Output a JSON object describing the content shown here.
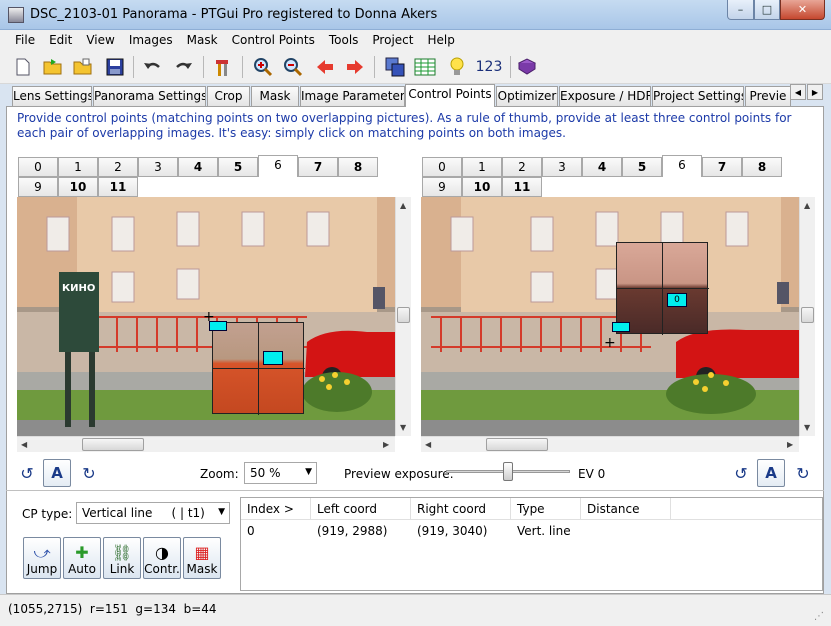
{
  "window": {
    "title": "DSC_2103-01 Panorama - PTGui Pro registered to Donna Akers",
    "min": "–",
    "max": "□",
    "close": "✕"
  },
  "menu": [
    "File",
    "Edit",
    "View",
    "Images",
    "Mask",
    "Control Points",
    "Tools",
    "Project",
    "Help"
  ],
  "toolbar": {
    "icons": [
      "new-file-icon",
      "open-icon",
      "open-recent-icon",
      "save-icon",
      "undo-icon",
      "redo-icon",
      "tools-icon",
      "zoom-in-icon",
      "zoom-out-icon",
      "arrow-left-icon",
      "arrow-right-icon",
      "copy-images-icon",
      "table-icon",
      "bulb-icon",
      "numbers-icon",
      "book-icon"
    ],
    "numbers_label": "123"
  },
  "tabs": [
    "Lens Settings",
    "Panorama Settings",
    "Crop",
    "Mask",
    "Image Parameters",
    "Control Points",
    "Optimizer",
    "Exposure / HDR",
    "Project Settings",
    "Previe"
  ],
  "active_tab": "Control Points",
  "instructions": "Provide control points (matching points on two overlapping pictures). As a rule of thumb, provide at least three control points for each pair of overlapping images. It's easy: simply click on matching points on both images.",
  "left_image_tabs": [
    "0",
    "1",
    "2",
    "3",
    "4",
    "5",
    "6",
    "7",
    "8",
    "9",
    "10",
    "11"
  ],
  "right_image_tabs": [
    "0",
    "1",
    "2",
    "3",
    "4",
    "5",
    "6",
    "7",
    "8",
    "9",
    "10",
    "11"
  ],
  "left_active": "6",
  "right_active": "6",
  "photo": {
    "sign_text": "КИНО",
    "marker_label": "0"
  },
  "zoom": {
    "label": "Zoom:",
    "value": "50 %",
    "a_label": "A"
  },
  "preview": {
    "label": "Preview exposure:",
    "ev": "EV 0",
    "level": 0.5
  },
  "cp_type": {
    "label": "CP type:",
    "value": "Vertical line     ( | t1)"
  },
  "cp_buttons": [
    {
      "label": "Jump",
      "icon": "jump-icon"
    },
    {
      "label": "Auto",
      "icon": "auto-icon"
    },
    {
      "label": "Link",
      "icon": "link-icon"
    },
    {
      "label": "Contr.",
      "icon": "contrast-icon"
    },
    {
      "label": "Mask",
      "icon": "mask-icon"
    }
  ],
  "table": {
    "headers": [
      "Index >",
      "Left coord",
      "Right coord",
      "Type",
      "Distance"
    ],
    "rows": [
      [
        "0",
        "(919, 2988)",
        "(919, 3040)",
        "Vert. line",
        ""
      ]
    ]
  },
  "status": "(1055,2715)  r=151  g=134  b=44"
}
